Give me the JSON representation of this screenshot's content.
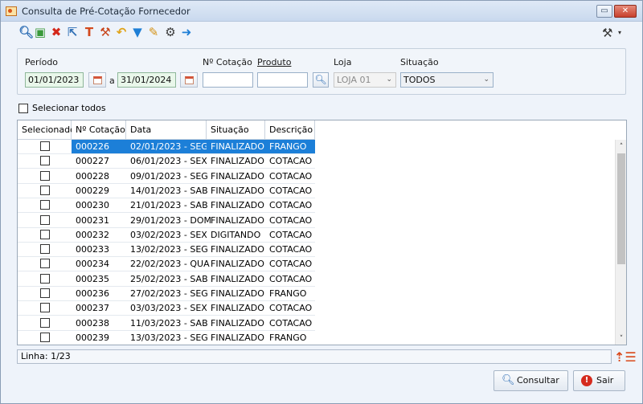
{
  "window": {
    "title": "Consulta de Pré-Cotação Fornecedor",
    "restore_label": "▭",
    "close_label": "✕"
  },
  "toolbar": {
    "icons": [
      {
        "name": "search-icon",
        "glyph": "🔍︎",
        "color": "#2f6fb5"
      },
      {
        "name": "new-document-icon",
        "glyph": "▣",
        "color": "#3a9a3a"
      },
      {
        "name": "delete-icon",
        "glyph": "✖",
        "color": "#d4281b"
      },
      {
        "name": "export-icon",
        "glyph": "⇱",
        "color": "#2f6fb5"
      },
      {
        "name": "column-icon",
        "glyph": "T",
        "color": "#d34a1e"
      },
      {
        "name": "wrench-icon",
        "glyph": "⚒",
        "color": "#c8451b"
      },
      {
        "name": "undo-icon",
        "glyph": "↶",
        "color": "#e0a318"
      },
      {
        "name": "filter-icon",
        "glyph": "▼",
        "color": "#1f7fd6"
      },
      {
        "name": "edit-icon",
        "glyph": "✎",
        "color": "#d49216"
      },
      {
        "name": "settings-gear-icon",
        "glyph": "⚙",
        "color": "#3a3a3a"
      },
      {
        "name": "forward-icon",
        "glyph": "➜",
        "color": "#1f7fd6"
      }
    ],
    "tools_glyph": "⚒",
    "tools_dropdown": "▾"
  },
  "filters": {
    "periodo_label": "Período",
    "date_from": "01/01/2023",
    "date_sep": "a",
    "date_to": "31/01/2024",
    "cotacao_label": "Nº Cotação",
    "cotacao_value": "",
    "produto_label": "Produto",
    "produto_value": "",
    "loja_label": "Loja",
    "loja_value": "LOJA 01",
    "situacao_label": "Situação",
    "situacao_value": "TODOS",
    "search_glyph": "🔍︎",
    "dropdown_glyph": "⌄"
  },
  "select_all_label": "Selecionar todos",
  "grid": {
    "columns": [
      "Selecionado",
      "Nº Cotação",
      "Data",
      "Situação",
      "Descrição"
    ],
    "rows": [
      {
        "cotacao": "000226",
        "data": "02/01/2023 - SEG",
        "situacao": "FINALIZADO",
        "descricao": "FRANGO"
      },
      {
        "cotacao": "000227",
        "data": "06/01/2023 - SEX",
        "situacao": "FINALIZADO",
        "descricao": "COTACAO"
      },
      {
        "cotacao": "000228",
        "data": "09/01/2023 - SEG",
        "situacao": "FINALIZADO",
        "descricao": "COTACAO"
      },
      {
        "cotacao": "000229",
        "data": "14/01/2023 - SAB",
        "situacao": "FINALIZADO",
        "descricao": "COTACAO"
      },
      {
        "cotacao": "000230",
        "data": "21/01/2023 - SAB",
        "situacao": "FINALIZADO",
        "descricao": "COTACAO"
      },
      {
        "cotacao": "000231",
        "data": "29/01/2023 - DOM",
        "situacao": "FINALIZADO",
        "descricao": "COTACAO"
      },
      {
        "cotacao": "000232",
        "data": "03/02/2023 - SEX",
        "situacao": "DIGITANDO",
        "descricao": "COTACAO"
      },
      {
        "cotacao": "000233",
        "data": "13/02/2023 - SEG",
        "situacao": "FINALIZADO",
        "descricao": "COTACAO"
      },
      {
        "cotacao": "000234",
        "data": "22/02/2023 - QUA",
        "situacao": "FINALIZADO",
        "descricao": "COTACAO"
      },
      {
        "cotacao": "000235",
        "data": "25/02/2023 - SAB",
        "situacao": "FINALIZADO",
        "descricao": "COTACAO"
      },
      {
        "cotacao": "000236",
        "data": "27/02/2023 - SEG",
        "situacao": "FINALIZADO",
        "descricao": "FRANGO"
      },
      {
        "cotacao": "000237",
        "data": "03/03/2023 - SEX",
        "situacao": "FINALIZADO",
        "descricao": "COTACAO"
      },
      {
        "cotacao": "000238",
        "data": "11/03/2023 - SAB",
        "situacao": "FINALIZADO",
        "descricao": "COTACAO"
      },
      {
        "cotacao": "000239",
        "data": "13/03/2023 - SEG",
        "situacao": "FINALIZADO",
        "descricao": "FRANGO"
      }
    ],
    "selected_row": 0,
    "scroll_up": "˄",
    "scroll_down": "˅"
  },
  "status": {
    "linha_text": "Linha: 1/23",
    "sort_glyph": "⇡☰"
  },
  "buttons": {
    "consultar_label": "Consultar",
    "consultar_glyph": "🔍︎",
    "sair_label": "Sair",
    "sair_glyph": "!"
  },
  "colors": {
    "selection": "#1c7fd8",
    "date_field": "#e9f7ea",
    "close_button": "#c8402d"
  }
}
